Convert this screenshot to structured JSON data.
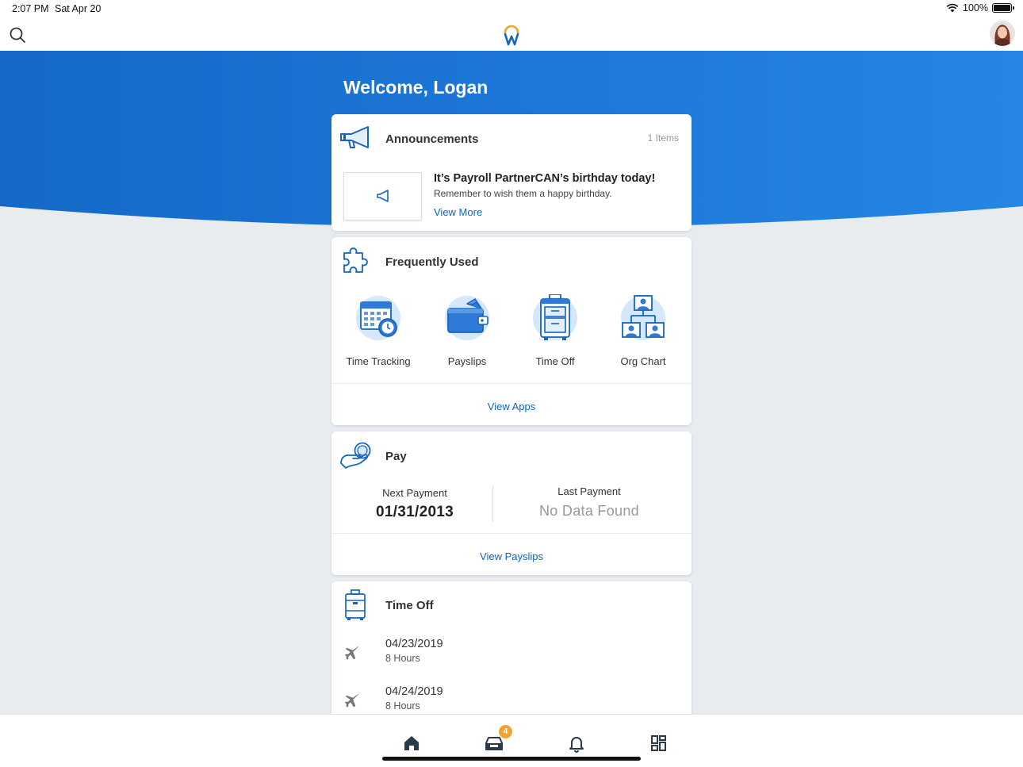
{
  "status_bar": {
    "time": "2:07 PM",
    "date": "Sat Apr 20",
    "battery": "100%"
  },
  "colors": {
    "brand_blue": "#1e7ad9",
    "link_blue": "#0b65c2",
    "logo_orange": "#f0a32e",
    "badge_orange": "#f0a32e"
  },
  "welcome": "Welcome, Logan",
  "announcements": {
    "title": "Announcements",
    "count": "1 Items",
    "headline": "It’s Payroll PartnerCAN’s birthday today!",
    "body": "Remember to wish them a happy birthday.",
    "link": "View More"
  },
  "frequently_used": {
    "title": "Frequently Used",
    "apps": [
      {
        "label": "Time Tracking",
        "icon": "time-tracking-icon"
      },
      {
        "label": "Payslips",
        "icon": "wallet-icon"
      },
      {
        "label": "Time Off",
        "icon": "suitcase-icon"
      },
      {
        "label": "Org Chart",
        "icon": "org-chart-icon"
      }
    ],
    "link": "View Apps"
  },
  "pay": {
    "title": "Pay",
    "next_label": "Next Payment",
    "next_value": "01/31/2013",
    "last_label": "Last Payment",
    "last_value": "No Data Found",
    "link": "View Payslips"
  },
  "time_off": {
    "title": "Time Off",
    "entries": [
      {
        "date": "04/23/2019",
        "hours": "8 Hours"
      },
      {
        "date": "04/24/2019",
        "hours": "8 Hours"
      }
    ]
  },
  "tabbar": {
    "items": [
      "home-icon",
      "inbox-icon",
      "bell-icon",
      "apps-grid-icon"
    ],
    "inbox_badge": "4"
  }
}
